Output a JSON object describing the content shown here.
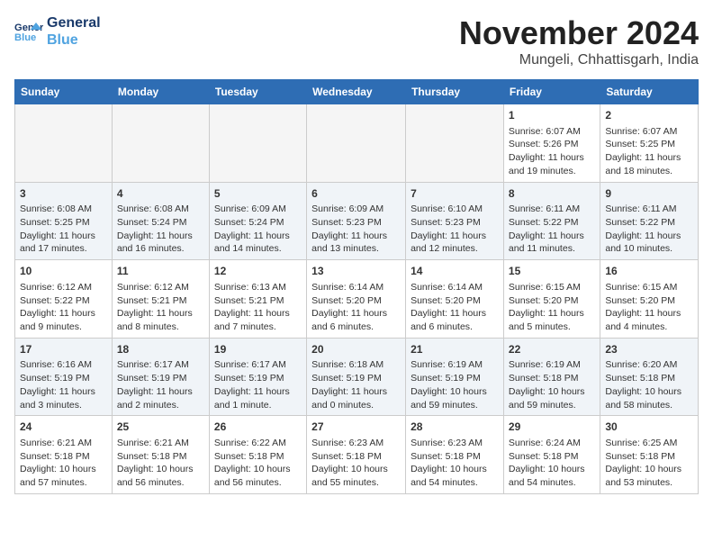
{
  "logo": {
    "line1": "General",
    "line2": "Blue"
  },
  "title": "November 2024",
  "location": "Mungeli, Chhattisgarh, India",
  "days_of_week": [
    "Sunday",
    "Monday",
    "Tuesday",
    "Wednesday",
    "Thursday",
    "Friday",
    "Saturday"
  ],
  "weeks": [
    [
      {
        "day": "",
        "empty": true
      },
      {
        "day": "",
        "empty": true
      },
      {
        "day": "",
        "empty": true
      },
      {
        "day": "",
        "empty": true
      },
      {
        "day": "",
        "empty": true
      },
      {
        "day": "1",
        "sunrise": "6:07 AM",
        "sunset": "5:26 PM",
        "daylight": "11 hours and 19 minutes."
      },
      {
        "day": "2",
        "sunrise": "6:07 AM",
        "sunset": "5:25 PM",
        "daylight": "11 hours and 18 minutes."
      }
    ],
    [
      {
        "day": "3",
        "sunrise": "6:08 AM",
        "sunset": "5:25 PM",
        "daylight": "11 hours and 17 minutes."
      },
      {
        "day": "4",
        "sunrise": "6:08 AM",
        "sunset": "5:24 PM",
        "daylight": "11 hours and 16 minutes."
      },
      {
        "day": "5",
        "sunrise": "6:09 AM",
        "sunset": "5:24 PM",
        "daylight": "11 hours and 14 minutes."
      },
      {
        "day": "6",
        "sunrise": "6:09 AM",
        "sunset": "5:23 PM",
        "daylight": "11 hours and 13 minutes."
      },
      {
        "day": "7",
        "sunrise": "6:10 AM",
        "sunset": "5:23 PM",
        "daylight": "11 hours and 12 minutes."
      },
      {
        "day": "8",
        "sunrise": "6:11 AM",
        "sunset": "5:22 PM",
        "daylight": "11 hours and 11 minutes."
      },
      {
        "day": "9",
        "sunrise": "6:11 AM",
        "sunset": "5:22 PM",
        "daylight": "11 hours and 10 minutes."
      }
    ],
    [
      {
        "day": "10",
        "sunrise": "6:12 AM",
        "sunset": "5:22 PM",
        "daylight": "11 hours and 9 minutes."
      },
      {
        "day": "11",
        "sunrise": "6:12 AM",
        "sunset": "5:21 PM",
        "daylight": "11 hours and 8 minutes."
      },
      {
        "day": "12",
        "sunrise": "6:13 AM",
        "sunset": "5:21 PM",
        "daylight": "11 hours and 7 minutes."
      },
      {
        "day": "13",
        "sunrise": "6:14 AM",
        "sunset": "5:20 PM",
        "daylight": "11 hours and 6 minutes."
      },
      {
        "day": "14",
        "sunrise": "6:14 AM",
        "sunset": "5:20 PM",
        "daylight": "11 hours and 6 minutes."
      },
      {
        "day": "15",
        "sunrise": "6:15 AM",
        "sunset": "5:20 PM",
        "daylight": "11 hours and 5 minutes."
      },
      {
        "day": "16",
        "sunrise": "6:15 AM",
        "sunset": "5:20 PM",
        "daylight": "11 hours and 4 minutes."
      }
    ],
    [
      {
        "day": "17",
        "sunrise": "6:16 AM",
        "sunset": "5:19 PM",
        "daylight": "11 hours and 3 minutes."
      },
      {
        "day": "18",
        "sunrise": "6:17 AM",
        "sunset": "5:19 PM",
        "daylight": "11 hours and 2 minutes."
      },
      {
        "day": "19",
        "sunrise": "6:17 AM",
        "sunset": "5:19 PM",
        "daylight": "11 hours and 1 minute."
      },
      {
        "day": "20",
        "sunrise": "6:18 AM",
        "sunset": "5:19 PM",
        "daylight": "11 hours and 0 minutes."
      },
      {
        "day": "21",
        "sunrise": "6:19 AM",
        "sunset": "5:19 PM",
        "daylight": "10 hours and 59 minutes."
      },
      {
        "day": "22",
        "sunrise": "6:19 AM",
        "sunset": "5:18 PM",
        "daylight": "10 hours and 59 minutes."
      },
      {
        "day": "23",
        "sunrise": "6:20 AM",
        "sunset": "5:18 PM",
        "daylight": "10 hours and 58 minutes."
      }
    ],
    [
      {
        "day": "24",
        "sunrise": "6:21 AM",
        "sunset": "5:18 PM",
        "daylight": "10 hours and 57 minutes."
      },
      {
        "day": "25",
        "sunrise": "6:21 AM",
        "sunset": "5:18 PM",
        "daylight": "10 hours and 56 minutes."
      },
      {
        "day": "26",
        "sunrise": "6:22 AM",
        "sunset": "5:18 PM",
        "daylight": "10 hours and 56 minutes."
      },
      {
        "day": "27",
        "sunrise": "6:23 AM",
        "sunset": "5:18 PM",
        "daylight": "10 hours and 55 minutes."
      },
      {
        "day": "28",
        "sunrise": "6:23 AM",
        "sunset": "5:18 PM",
        "daylight": "10 hours and 54 minutes."
      },
      {
        "day": "29",
        "sunrise": "6:24 AM",
        "sunset": "5:18 PM",
        "daylight": "10 hours and 54 minutes."
      },
      {
        "day": "30",
        "sunrise": "6:25 AM",
        "sunset": "5:18 PM",
        "daylight": "10 hours and 53 minutes."
      }
    ]
  ]
}
